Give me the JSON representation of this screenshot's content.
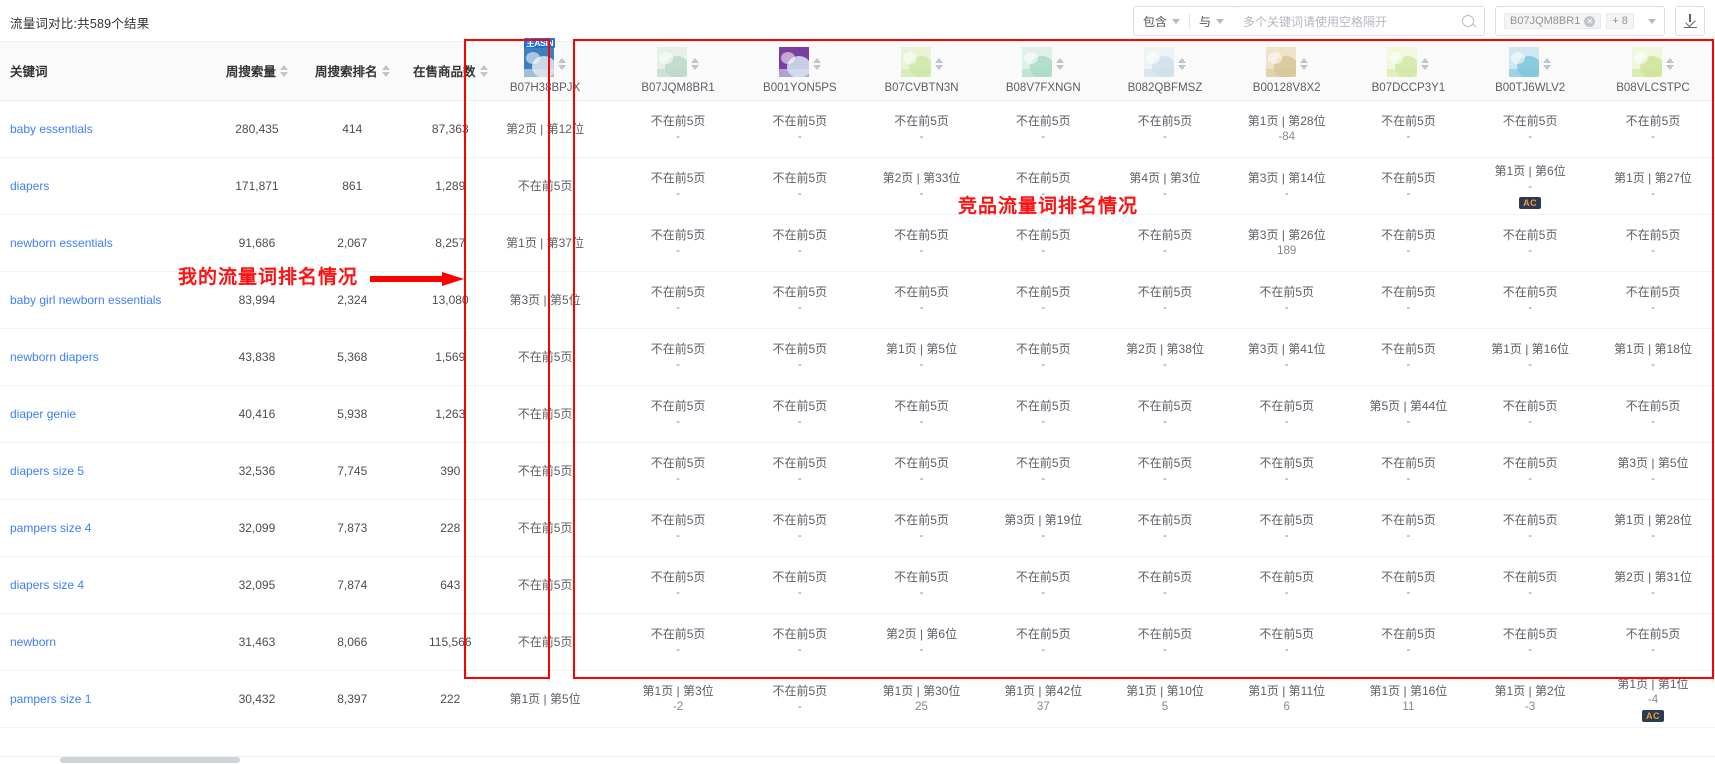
{
  "header": {
    "title": "流量词对比:共589个结果",
    "filters": {
      "match_mode": "包含",
      "logic_mode": "与",
      "search_placeholder": "多个关键词请使用空格隔开",
      "search_value": "",
      "selected_asin": "B07JQM8BR1",
      "more_count": "+ 8",
      "download_label": "导出"
    },
    "icons": {
      "search": "search-icon",
      "download": "download-icon",
      "chevron": "chevron-down-icon"
    }
  },
  "annotations": {
    "mine_label": "我的流量词排名情况",
    "competitor_label": "竞品流量词排名情况",
    "accent_red": "#ff0000"
  },
  "table": {
    "columns": [
      {
        "key": "keyword",
        "label": "关键词",
        "sortable": false
      },
      {
        "key": "weekly_search_volume",
        "label": "周搜索量",
        "sortable": true
      },
      {
        "key": "weekly_search_rank",
        "label": "周搜索排名",
        "sortable": true
      },
      {
        "key": "products_on_sale",
        "label": "在售商品数",
        "sortable": true
      }
    ],
    "main_asin": {
      "asin": "B07H38BPJX",
      "badge": "主ASIN",
      "thumb_colors": [
        "#3f7fbf",
        "#dfe8ef"
      ]
    },
    "competitor_asins": [
      {
        "asin": "B07JQM8BR1",
        "thumb_colors": [
          "#e7efe9",
          "#bcd9c8"
        ]
      },
      {
        "asin": "B001YON5PS",
        "thumb_colors": [
          "#7c3fa0",
          "#d6e6f2"
        ]
      },
      {
        "asin": "B07CVBTN3N",
        "thumb_colors": [
          "#e9f3d8",
          "#cfe8a8"
        ]
      },
      {
        "asin": "B08V7FXNGN",
        "thumb_colors": [
          "#dff0e8",
          "#a9dcc5"
        ]
      },
      {
        "asin": "B082QBFMSZ",
        "thumb_colors": [
          "#eef3f6",
          "#cfe0ea"
        ]
      },
      {
        "asin": "B00128V8X2",
        "thumb_colors": [
          "#efe3c8",
          "#d8c79a"
        ]
      },
      {
        "asin": "B07DCCP3Y1",
        "thumb_colors": [
          "#f2f7dd",
          "#d4e9a6"
        ]
      },
      {
        "asin": "B00TJ6WLV2",
        "thumb_colors": [
          "#cfe7ef",
          "#7fc6dc"
        ]
      },
      {
        "asin": "B08VLCSTPC",
        "thumb_colors": [
          "#f0f7de",
          "#cbe59a"
        ]
      }
    ],
    "not_in_top5": "不在前5页",
    "dash": "-",
    "ac_label": "AC",
    "rows": [
      {
        "keyword": "baby essentials",
        "weekly_search_volume": "280,435",
        "weekly_search_rank": "414",
        "products_on_sale": "87,363",
        "main": {
          "rank": "第2页 | 第12位"
        },
        "cells": [
          {
            "rank": "不在前5页",
            "sub": "-"
          },
          {
            "rank": "不在前5页",
            "sub": "-"
          },
          {
            "rank": "不在前5页",
            "sub": "-"
          },
          {
            "rank": "不在前5页",
            "sub": "-"
          },
          {
            "rank": "不在前5页",
            "sub": "-"
          },
          {
            "rank": "第1页 | 第28位",
            "sub": "-84"
          },
          {
            "rank": "不在前5页",
            "sub": "-"
          },
          {
            "rank": "不在前5页",
            "sub": "-"
          },
          {
            "rank": "不在前5页",
            "sub": "-"
          }
        ]
      },
      {
        "keyword": "diapers",
        "weekly_search_volume": "171,871",
        "weekly_search_rank": "861",
        "products_on_sale": "1,289",
        "main": {
          "rank": "不在前5页"
        },
        "cells": [
          {
            "rank": "不在前5页",
            "sub": "-"
          },
          {
            "rank": "不在前5页",
            "sub": "-"
          },
          {
            "rank": "第2页 | 第33位",
            "sub": "-"
          },
          {
            "rank": "不在前5页",
            "sub": "-"
          },
          {
            "rank": "第4页 | 第3位",
            "sub": "-"
          },
          {
            "rank": "第3页 | 第14位",
            "sub": "-"
          },
          {
            "rank": "不在前5页",
            "sub": "-"
          },
          {
            "rank": "第1页 | 第6位",
            "sub": "-",
            "ac": true
          },
          {
            "rank": "第1页 | 第27位",
            "sub": "-"
          }
        ]
      },
      {
        "keyword": "newborn essentials",
        "weekly_search_volume": "91,686",
        "weekly_search_rank": "2,067",
        "products_on_sale": "8,257",
        "main": {
          "rank": "第1页 | 第37位"
        },
        "cells": [
          {
            "rank": "不在前5页",
            "sub": "-"
          },
          {
            "rank": "不在前5页",
            "sub": "-"
          },
          {
            "rank": "不在前5页",
            "sub": "-"
          },
          {
            "rank": "不在前5页",
            "sub": "-"
          },
          {
            "rank": "不在前5页",
            "sub": "-"
          },
          {
            "rank": "第3页 | 第26位",
            "sub": "189"
          },
          {
            "rank": "不在前5页",
            "sub": "-"
          },
          {
            "rank": "不在前5页",
            "sub": "-"
          },
          {
            "rank": "不在前5页",
            "sub": "-"
          }
        ]
      },
      {
        "keyword": "baby girl newborn essentials",
        "weekly_search_volume": "83,994",
        "weekly_search_rank": "2,324",
        "products_on_sale": "13,080",
        "main": {
          "rank": "第3页 | 第5位"
        },
        "cells": [
          {
            "rank": "不在前5页",
            "sub": "-"
          },
          {
            "rank": "不在前5页",
            "sub": "-"
          },
          {
            "rank": "不在前5页",
            "sub": "-"
          },
          {
            "rank": "不在前5页",
            "sub": "-"
          },
          {
            "rank": "不在前5页",
            "sub": "-"
          },
          {
            "rank": "不在前5页",
            "sub": "-"
          },
          {
            "rank": "不在前5页",
            "sub": "-"
          },
          {
            "rank": "不在前5页",
            "sub": "-"
          },
          {
            "rank": "不在前5页",
            "sub": "-"
          }
        ]
      },
      {
        "keyword": "newborn diapers",
        "weekly_search_volume": "43,838",
        "weekly_search_rank": "5,368",
        "products_on_sale": "1,569",
        "main": {
          "rank": "不在前5页"
        },
        "cells": [
          {
            "rank": "不在前5页",
            "sub": "-"
          },
          {
            "rank": "不在前5页",
            "sub": "-"
          },
          {
            "rank": "第1页 | 第5位",
            "sub": "-"
          },
          {
            "rank": "不在前5页",
            "sub": "-"
          },
          {
            "rank": "第2页 | 第38位",
            "sub": "-"
          },
          {
            "rank": "第3页 | 第41位",
            "sub": "-"
          },
          {
            "rank": "不在前5页",
            "sub": "-"
          },
          {
            "rank": "第1页 | 第16位",
            "sub": "-"
          },
          {
            "rank": "第1页 | 第18位",
            "sub": "-"
          }
        ]
      },
      {
        "keyword": "diaper genie",
        "weekly_search_volume": "40,416",
        "weekly_search_rank": "5,938",
        "products_on_sale": "1,263",
        "main": {
          "rank": "不在前5页"
        },
        "cells": [
          {
            "rank": "不在前5页",
            "sub": "-"
          },
          {
            "rank": "不在前5页",
            "sub": "-"
          },
          {
            "rank": "不在前5页",
            "sub": "-"
          },
          {
            "rank": "不在前5页",
            "sub": "-"
          },
          {
            "rank": "不在前5页",
            "sub": "-"
          },
          {
            "rank": "不在前5页",
            "sub": "-"
          },
          {
            "rank": "第5页 | 第44位",
            "sub": "-"
          },
          {
            "rank": "不在前5页",
            "sub": "-"
          },
          {
            "rank": "不在前5页",
            "sub": "-"
          }
        ]
      },
      {
        "keyword": "diapers size 5",
        "weekly_search_volume": "32,536",
        "weekly_search_rank": "7,745",
        "products_on_sale": "390",
        "main": {
          "rank": "不在前5页"
        },
        "cells": [
          {
            "rank": "不在前5页",
            "sub": "-"
          },
          {
            "rank": "不在前5页",
            "sub": "-"
          },
          {
            "rank": "不在前5页",
            "sub": "-"
          },
          {
            "rank": "不在前5页",
            "sub": "-"
          },
          {
            "rank": "不在前5页",
            "sub": "-"
          },
          {
            "rank": "不在前5页",
            "sub": "-"
          },
          {
            "rank": "不在前5页",
            "sub": "-"
          },
          {
            "rank": "不在前5页",
            "sub": "-"
          },
          {
            "rank": "第3页 | 第5位",
            "sub": "-"
          }
        ]
      },
      {
        "keyword": "pampers size 4",
        "weekly_search_volume": "32,099",
        "weekly_search_rank": "7,873",
        "products_on_sale": "228",
        "main": {
          "rank": "不在前5页"
        },
        "cells": [
          {
            "rank": "不在前5页",
            "sub": "-"
          },
          {
            "rank": "不在前5页",
            "sub": "-"
          },
          {
            "rank": "不在前5页",
            "sub": "-"
          },
          {
            "rank": "第3页 | 第19位",
            "sub": "-"
          },
          {
            "rank": "不在前5页",
            "sub": "-"
          },
          {
            "rank": "不在前5页",
            "sub": "-"
          },
          {
            "rank": "不在前5页",
            "sub": "-"
          },
          {
            "rank": "不在前5页",
            "sub": "-"
          },
          {
            "rank": "第1页 | 第28位",
            "sub": "-"
          }
        ]
      },
      {
        "keyword": "diapers size 4",
        "weekly_search_volume": "32,095",
        "weekly_search_rank": "7,874",
        "products_on_sale": "643",
        "main": {
          "rank": "不在前5页"
        },
        "cells": [
          {
            "rank": "不在前5页",
            "sub": "-"
          },
          {
            "rank": "不在前5页",
            "sub": "-"
          },
          {
            "rank": "不在前5页",
            "sub": "-"
          },
          {
            "rank": "不在前5页",
            "sub": "-"
          },
          {
            "rank": "不在前5页",
            "sub": "-"
          },
          {
            "rank": "不在前5页",
            "sub": "-"
          },
          {
            "rank": "不在前5页",
            "sub": "-"
          },
          {
            "rank": "不在前5页",
            "sub": "-"
          },
          {
            "rank": "第2页 | 第31位",
            "sub": "-"
          }
        ]
      },
      {
        "keyword": "newborn",
        "weekly_search_volume": "31,463",
        "weekly_search_rank": "8,066",
        "products_on_sale": "115,566",
        "main": {
          "rank": "不在前5页"
        },
        "cells": [
          {
            "rank": "不在前5页",
            "sub": "-"
          },
          {
            "rank": "不在前5页",
            "sub": "-"
          },
          {
            "rank": "第2页 | 第6位",
            "sub": "-"
          },
          {
            "rank": "不在前5页",
            "sub": "-"
          },
          {
            "rank": "不在前5页",
            "sub": "-"
          },
          {
            "rank": "不在前5页",
            "sub": "-"
          },
          {
            "rank": "不在前5页",
            "sub": "-"
          },
          {
            "rank": "不在前5页",
            "sub": "-"
          },
          {
            "rank": "不在前5页",
            "sub": "-"
          }
        ]
      },
      {
        "keyword": "pampers size 1",
        "weekly_search_volume": "30,432",
        "weekly_search_rank": "8,397",
        "products_on_sale": "222",
        "main": {
          "rank": "第1页 | 第5位"
        },
        "cells": [
          {
            "rank": "第1页 | 第3位",
            "sub": "-2"
          },
          {
            "rank": "不在前5页",
            "sub": "-"
          },
          {
            "rank": "第1页 | 第30位",
            "sub": "25"
          },
          {
            "rank": "第1页 | 第42位",
            "sub": "37"
          },
          {
            "rank": "第1页 | 第10位",
            "sub": "5"
          },
          {
            "rank": "第1页 | 第11位",
            "sub": "6"
          },
          {
            "rank": "第1页 | 第16位",
            "sub": "11"
          },
          {
            "rank": "第1页 | 第2位",
            "sub": "-3"
          },
          {
            "rank": "第1页 | 第1位",
            "sub": "-4",
            "ac": true
          }
        ]
      }
    ]
  }
}
